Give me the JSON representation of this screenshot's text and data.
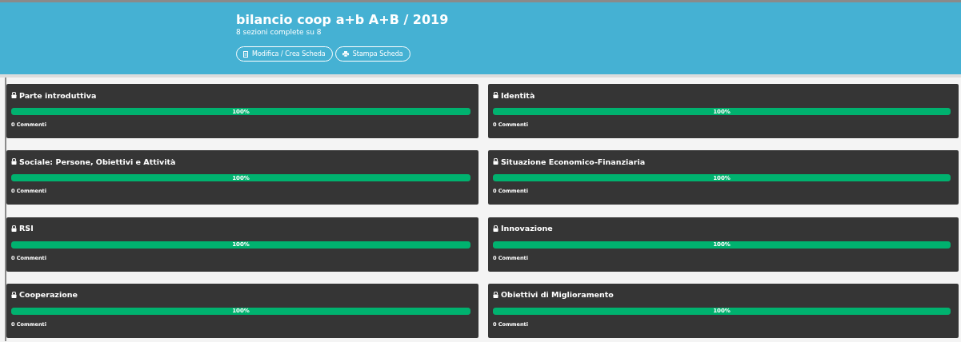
{
  "header": {
    "title": "bilancio coop a+b A+B / 2019",
    "subtitle": "8 sezioni complete su 8",
    "buttons": [
      {
        "kind": "edit",
        "label": "Modifica / Crea Scheda"
      },
      {
        "kind": "print",
        "label": "Stampa Scheda"
      }
    ]
  },
  "sections": [
    {
      "title": "Parte introduttiva",
      "locked": true,
      "level": 1,
      "percent": "100%",
      "comments": "0 Commenti"
    },
    {
      "title": "Identità",
      "locked": true,
      "level": 1,
      "percent": "100%",
      "comments": "0 Commenti"
    },
    {
      "title": "Sociale: Persone, Obiettivi e Attività",
      "locked": true,
      "level": 1,
      "percent": "100%",
      "comments": "0 Commenti"
    },
    {
      "title": "Situazione Economico-Finanziaria",
      "locked": true,
      "level": 1,
      "percent": "100%",
      "comments": "0 Commenti"
    },
    {
      "title": "RSI",
      "locked": true,
      "level": 1,
      "percent": "100%",
      "comments": "0 Commenti"
    },
    {
      "title": "Innovazione",
      "locked": true,
      "level": 1,
      "percent": "100%",
      "comments": "0 Commenti"
    },
    {
      "title": "Cooperazione",
      "locked": true,
      "level": 1,
      "percent": "100%",
      "comments": "0 Commenti"
    },
    {
      "title": "Obiettivi di Miglioramento",
      "locked": true,
      "level": 1,
      "percent": "100%",
      "comments": "0 Commenti"
    }
  ]
}
